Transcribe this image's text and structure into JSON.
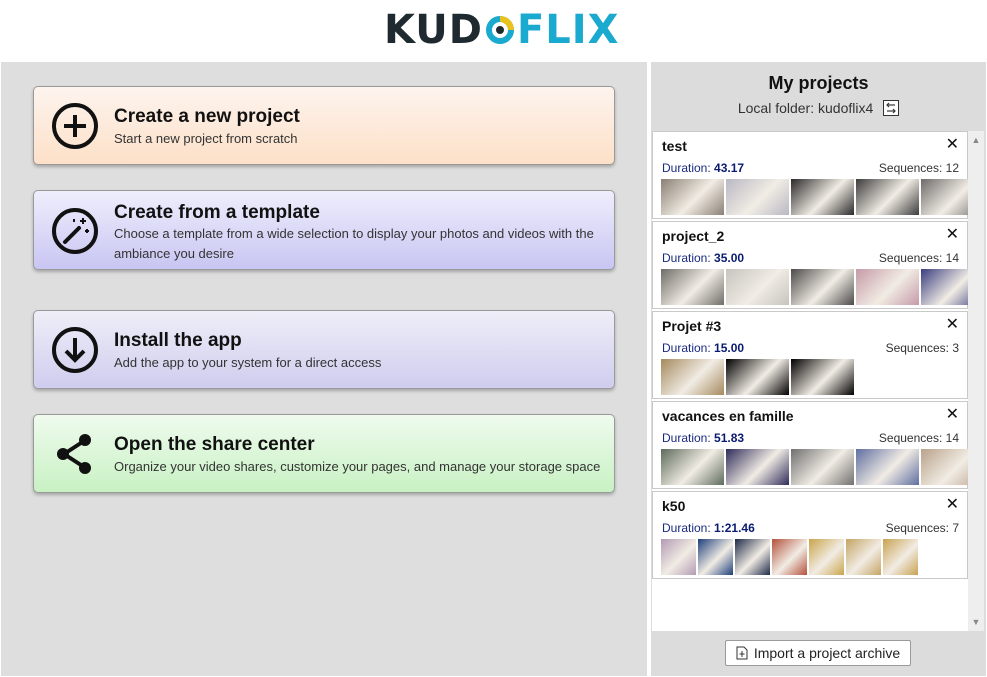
{
  "brand": {
    "logo_k": "KUD",
    "logo_flix": "FLIX",
    "colors": {
      "dark": "#1f2a30",
      "blue": "#1aa9cf",
      "yellow": "#e9c21b"
    }
  },
  "actions": [
    {
      "title": "Create a new project",
      "desc": "Start a new project from scratch",
      "icon": "plus-circle-icon"
    },
    {
      "title": "Create from a template",
      "desc": "Choose a template from a wide selection to display your photos and videos with the ambiance you desire",
      "icon": "magic-wand-icon"
    },
    {
      "title": "Install the app",
      "desc": "Add the app to your system for a direct access",
      "icon": "download-circle-icon"
    },
    {
      "title": "Open the share center",
      "desc": "Organize your video shares, customize your pages, and manage your storage space",
      "icon": "share-icon"
    }
  ],
  "projects_panel": {
    "title": "My projects",
    "folder_label": "Local folder: kudoflix4",
    "import_label": "Import a project archive",
    "duration_label": "Duration:",
    "sequences_label": "Sequences:",
    "projects": [
      {
        "name": "test",
        "duration": "43.17",
        "sequences": "12",
        "thumbs": [
          "#8a7f74",
          "#b9b8c4",
          "#2a2a2a",
          "#3c3c3c",
          "#6d6a6a"
        ]
      },
      {
        "name": "project_2",
        "duration": "35.00",
        "sequences": "14",
        "thumbs": [
          "#6f6d68",
          "#c6c4bf",
          "#4a4a4a",
          "#c59aa8",
          "#3a3d80"
        ]
      },
      {
        "name": "Projet #3",
        "duration": "15.00",
        "sequences": "3",
        "thumbs": [
          "#a58a5e",
          "#000000",
          "#000000"
        ]
      },
      {
        "name": "vacances en famille",
        "duration": "51.83",
        "sequences": "14",
        "thumbs": [
          "#5d6a5c",
          "#2f2c5a",
          "#707070",
          "#5f6ea0",
          "#b9a28a"
        ]
      },
      {
        "name": "k50",
        "duration": "1:21.46",
        "sequences": "7",
        "thumbs": [
          "#b39bb3",
          "#1e3f7a",
          "#1e2a48",
          "#b4503a",
          "#c9a44a",
          "#c5a463",
          "#c9a24f"
        ]
      }
    ]
  }
}
